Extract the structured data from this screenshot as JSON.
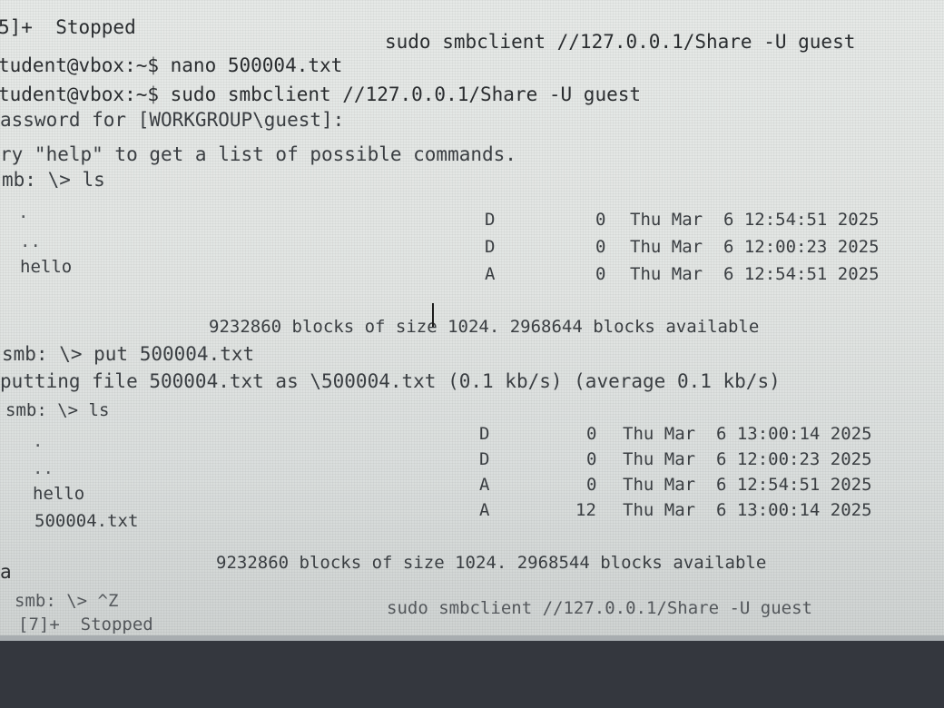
{
  "terminal": {
    "lines": [
      "5]+  Stopped",
      "sudo smbclient //127.0.0.1/Share -U guest",
      "tudent@vbox:~$ nano 500004.txt",
      "tudent@vbox:~$ sudo smbclient //127.0.0.1/Share -U guest",
      "assword for [WORKGROUP\\guest]:",
      "ry \"help\" to get a list of possible commands.",
      "mb: \\> ls",
      ".",
      "D",
      "0",
      "Thu Mar  6 12:54:51 2025",
      "..",
      "D",
      "0",
      "Thu Mar  6 12:00:23 2025",
      "hello",
      "A",
      "0",
      "Thu Mar  6 12:54:51 2025",
      "9232860 blocks of size 1024. 2968644 blocks available",
      "smb: \\> put 500004.txt",
      "putting file 500004.txt as \\500004.txt (0.1 kb/s) (average 0.1 kb/s)",
      "smb: \\> ls",
      ".",
      "D",
      "0",
      "Thu Mar  6 13:00:14 2025",
      "..",
      "D",
      "0",
      "Thu Mar  6 12:00:23 2025",
      "hello",
      "A",
      "0",
      "Thu Mar  6 12:54:51 2025",
      "500004.txt",
      "A",
      "12",
      "Thu Mar  6 13:00:14 2025",
      "a",
      "9232860 blocks of size 1024. 2968544 blocks available",
      "smb: \\> ^Z",
      "[7]+  Stopped",
      "sudo smbclient //127.0.0.1/Share -U guest"
    ]
  },
  "colors": {
    "terminal_bg": "#e4e7e5",
    "terminal_text": "#3b3f43",
    "bezel": "#34373e"
  }
}
